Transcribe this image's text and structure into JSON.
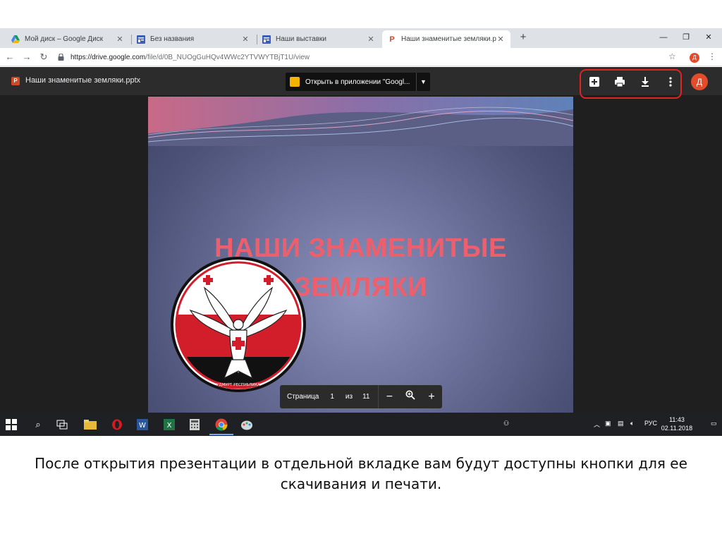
{
  "browser": {
    "tabs": [
      {
        "title": "Мой диск – Google Диск",
        "icon": "drive-icon",
        "active": false
      },
      {
        "title": "Без названия",
        "icon": "form-icon",
        "active": false
      },
      {
        "title": "Наши выставки",
        "icon": "form-icon",
        "active": false
      },
      {
        "title": "Наши знаменитые земляки.pptx",
        "icon": "powerpoint-icon",
        "active": true
      }
    ],
    "url_host": "https://drive.google.com",
    "url_path": "/file/d/0B_NUOgGuHQv4WWc2YTVWYTBjT1U/view",
    "profile_initial": "Д"
  },
  "viewer": {
    "file_name": "Наши знаменитые земляки.pptx",
    "open_with_label": "Открыть в приложении \"Googl...",
    "avatar_initial": "Д",
    "highlight_color": "#e32222"
  },
  "slide": {
    "title_line1": "НАШИ ЗНАМЕНИТЫЕ",
    "title_line2": "ЗЕМЛЯКИ",
    "title_color": "#ee5f6e",
    "emblem_text": "УДМУРТ РЕСПУБЛИКА"
  },
  "pager": {
    "page_label": "Страница",
    "current": "1",
    "of_label": "из",
    "total": "11"
  },
  "taskbar": {
    "lang": "РУС",
    "time": "11:43",
    "date": "02.11.2018"
  },
  "caption": {
    "line1": "После открытия презентации в отдельной вкладке вам будут доступны кнопки для ее",
    "line2": "скачивания и печати."
  }
}
